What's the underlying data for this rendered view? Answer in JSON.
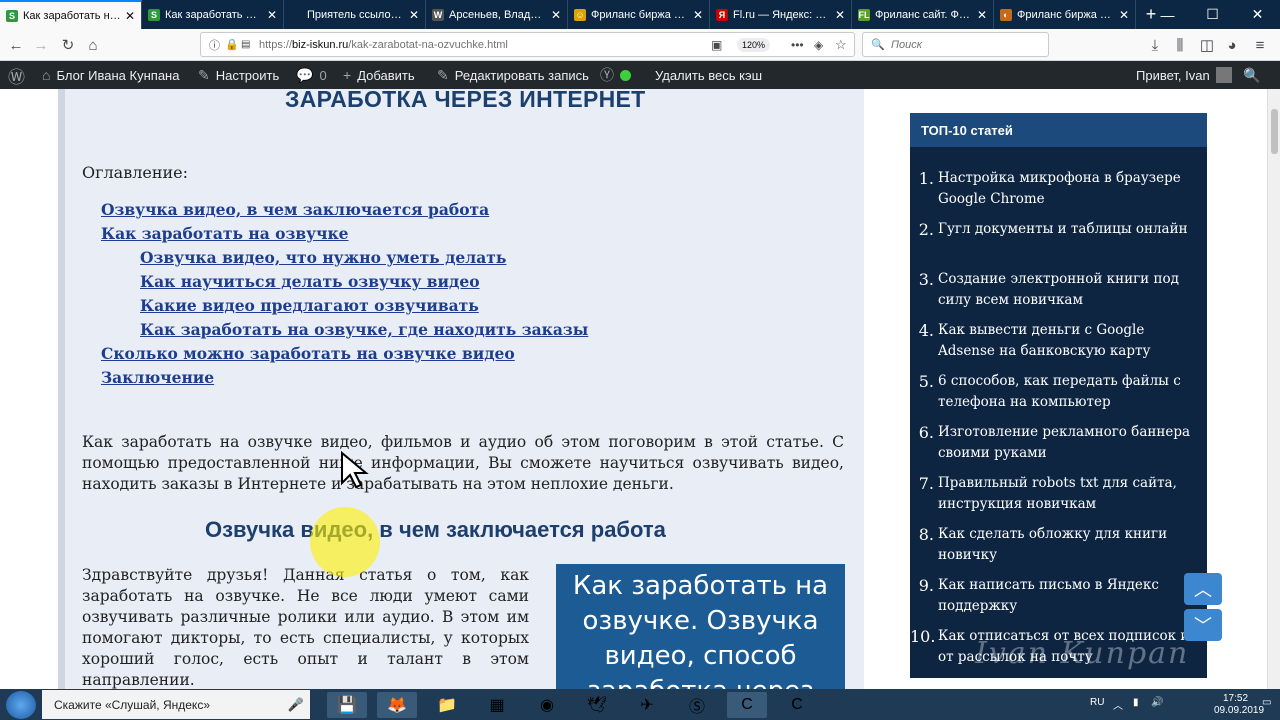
{
  "tabs": [
    {
      "title": "Как заработать на оз",
      "fav": "S",
      "favColor": "#2e9a3e",
      "active": true
    },
    {
      "title": "Как заработать деньг",
      "fav": "S",
      "favColor": "#2e9a3e"
    },
    {
      "title": "Приятель ссылок PRO: П",
      "fav": "",
      "favColor": "#0b2744"
    },
    {
      "title": "Арсеньев, Владимир",
      "fav": "W",
      "favColor": "#555"
    },
    {
      "title": "Фриланс биржа Free",
      "fav": "☺",
      "favColor": "#d9a300"
    },
    {
      "title": "Fl.ru — Яндекс: нашл",
      "fav": "Я",
      "favColor": "#c00"
    },
    {
      "title": "Фриланс сайт. Фрил",
      "fav": "FL",
      "favColor": "#5aa02c"
    },
    {
      "title": "Фриланс биржа удал",
      "fav": "◐",
      "favColor": "#c46a1a"
    }
  ],
  "browser": {
    "url_prefix": "https://",
    "url_host": "biz-iskun.ru",
    "url_path": "/kak-zarabotat-na-ozvuchke.html",
    "zoom": "120%",
    "search_placeholder": "Поиск"
  },
  "wpbar": {
    "blog": "Блог Ивана Кунпана",
    "customize": "Настроить",
    "comments": "0",
    "add": "Добавить",
    "edit": "Редактировать запись",
    "clear_cache": "Удалить весь кэш",
    "greeting": "Привет, Ivan"
  },
  "article": {
    "title": "ЗАРАБОТКА ЧЕРЕЗ ИНТЕРНЕТ",
    "toc_label": "Оглавление:",
    "toc": [
      {
        "text": "Озвучка видео, в чем заключается работа",
        "level": 1
      },
      {
        "text": "Как заработать на озвучке",
        "level": 1
      },
      {
        "text": "Озвучка видео, что нужно уметь делать",
        "level": 2
      },
      {
        "text": "Как научиться делать озвучку видео",
        "level": 2
      },
      {
        "text": "Какие видео предлагают озвучивать",
        "level": 2
      },
      {
        "text": "Как заработать на озвучке, где находить заказы",
        "level": 2
      },
      {
        "text": "Сколько можно заработать на озвучке видео",
        "level": 1
      },
      {
        "text": "Заключение",
        "level": 1
      }
    ],
    "intro": "Как заработать на озвучке видео, фильмов и аудио об этом поговорим в этой статье. С помощью предоставленной ниже информации, Вы сможете научиться озвучивать видео, находить заказы в Интернете и зарабатывать на этом неплохие деньги.",
    "h2": "Озвучка видео, в чем заключается работа",
    "para2": "Здравствуйте друзья! Данная статья о том, как заработать на озвучке. Не все люди умеют сами озвучивать различные ролики или аудио. В этом им помогают дикторы, то есть специалисты, у которых хороший голос, есть опыт и талант в этом направлении.",
    "image_text": "Как заработать на озвучке. Озвучка видео, способ заработка через"
  },
  "sidebar": {
    "title": "ТОП-10 статей",
    "items": [
      {
        "num": "1.",
        "text": "Настройка микрофона в браузере Google Chrome"
      },
      {
        "num": "2.",
        "text": "Гугл документы и таблицы онлайн"
      },
      {
        "num": "3.",
        "text": "Создание электронной книги под силу всем новичкам"
      },
      {
        "num": "4.",
        "text": "Как вывести деньги с Google Adsense на банковскую карту"
      },
      {
        "num": "5.",
        "text": "6 способов, как передать файлы с телефона на компьютер"
      },
      {
        "num": "6.",
        "text": "Изготовление рекламного баннера своими руками"
      },
      {
        "num": "7.",
        "text": "Правильный robots txt для сайта, инструкция новичкам"
      },
      {
        "num": "8.",
        "text": "Как сделать обложку для книги новичку"
      },
      {
        "num": "9.",
        "text": "Как написать письмо в Яндекс поддержку"
      },
      {
        "num": "10.",
        "text": "Как отписаться от всех подписок и от рассылок на почту"
      }
    ]
  },
  "watermark": "Ivan Kunpan",
  "taskbar": {
    "search": "Скажите «Слушай, Яндекс»",
    "lang": "RU",
    "time": "17:52",
    "date": "09.09.2019"
  }
}
